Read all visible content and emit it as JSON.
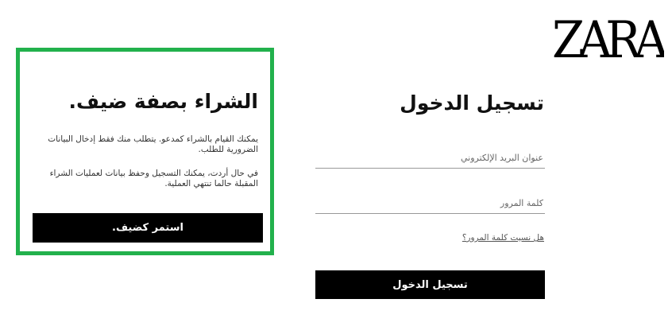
{
  "brand": {
    "logo_text": "ZARA"
  },
  "guest": {
    "title": "الشراء بصفة ضيف.",
    "description_1": "يمكنك القيام بالشراء كمدعو. يتطلب منك فقط إدخال البيانات الضرورية للطلب.",
    "description_2": "في حال أردت، يمكنك التسجيل وحفظ بيانات لعمليات الشراء المقبلة حالما تنتهي العملية.",
    "button_label": "استمر كضيف."
  },
  "login": {
    "title": "تسجيل الدخول",
    "email_placeholder": "عنوان البريد الإلكتروني",
    "password_placeholder": "كلمة المرور",
    "forgot_password_label": "هل نسيت كلمة المرور؟",
    "submit_label": "تسجيل الدخول"
  },
  "colors": {
    "highlight_border": "#22b14c",
    "button_background": "#000000",
    "button_text": "#ffffff"
  }
}
